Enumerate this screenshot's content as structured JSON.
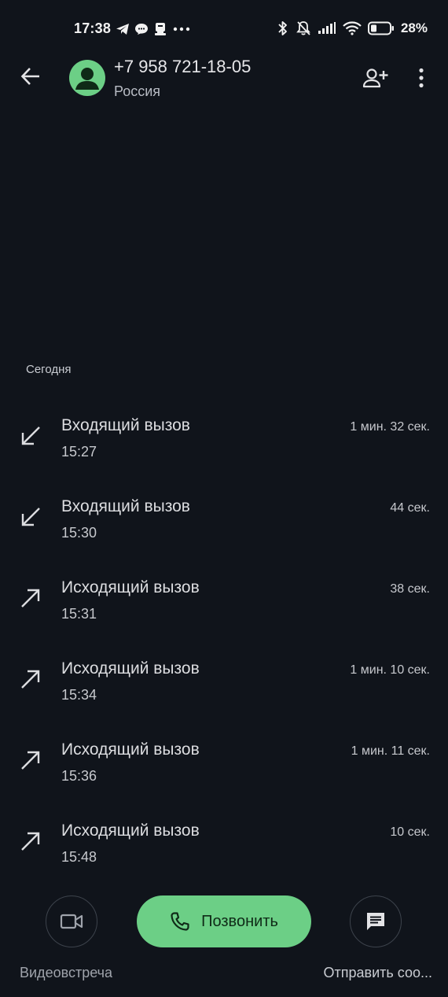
{
  "status_bar": {
    "time": "17:38",
    "battery_percent": "28%",
    "icons": [
      "telegram-icon",
      "chat-bubble-icon",
      "notification-icon",
      "more-dots-icon",
      "bluetooth-icon",
      "muted-bell-icon",
      "signal-icon",
      "wifi-icon",
      "battery-icon"
    ]
  },
  "header": {
    "number": "+7 958 721-18-05",
    "country": "Россия"
  },
  "section": {
    "heading": "Сегодня"
  },
  "calls": [
    {
      "direction": "incoming",
      "type": "Входящий вызов",
      "time": "15:27",
      "duration": "1 мин. 32 сек."
    },
    {
      "direction": "incoming",
      "type": "Входящий вызов",
      "time": "15:30",
      "duration": "44 сек."
    },
    {
      "direction": "outgoing",
      "type": "Исходящий вызов",
      "time": "15:31",
      "duration": "38 сек."
    },
    {
      "direction": "outgoing",
      "type": "Исходящий вызов",
      "time": "15:34",
      "duration": "1 мин. 10 сек."
    },
    {
      "direction": "outgoing",
      "type": "Исходящий вызов",
      "time": "15:36",
      "duration": "1 мин. 11 сек."
    },
    {
      "direction": "outgoing",
      "type": "Исходящий вызов",
      "time": "15:48",
      "duration": "10 сек."
    }
  ],
  "actions": {
    "call_label": "Позвонить",
    "video_label": "Видеовстреча",
    "message_label": "Отправить соо..."
  },
  "colors": {
    "background": "#10141b",
    "accent_green": "#6ccf86",
    "text_primary": "#dcdde0",
    "text_secondary": "#c6c8cd"
  }
}
